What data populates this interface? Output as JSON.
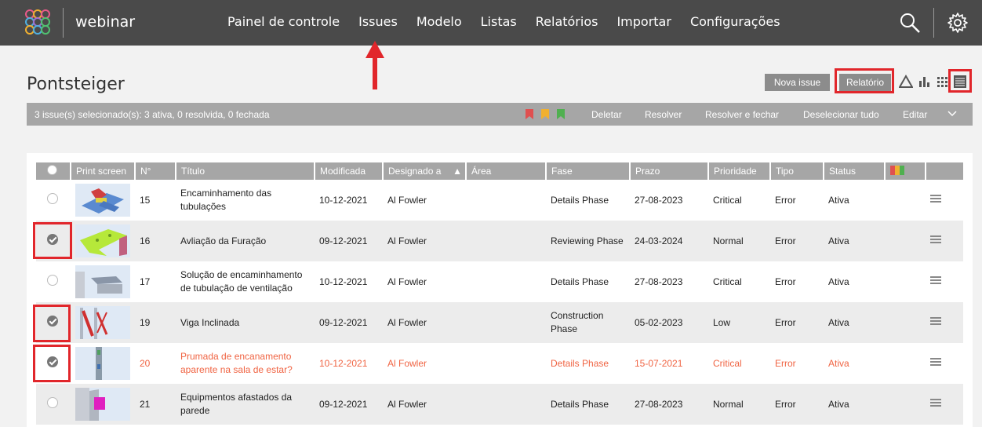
{
  "app": {
    "name": "webinar"
  },
  "nav": {
    "items": [
      "Painel de controle",
      "Issues",
      "Modelo",
      "Listas",
      "Relatórios",
      "Importar",
      "Configurações"
    ],
    "active": "Issues"
  },
  "page": {
    "title": "Pontsteiger"
  },
  "toolbar": {
    "new_issue": "Nova issue",
    "report": "Relatório"
  },
  "selection": {
    "summary": "3 issue(s) selecionado(s): 3 ativa, 0 resolvida, 0 fechada",
    "actions": [
      "Deletar",
      "Resolver",
      "Resolver e fechar",
      "Deselecionar tudo",
      "Editar"
    ],
    "flag_colors": [
      "#e05050",
      "#f0b030",
      "#50b050"
    ]
  },
  "table": {
    "headers": [
      "Print screen",
      "N°",
      "Título",
      "Modificada",
      "Designado a",
      "Área",
      "Fase",
      "Prazo",
      "Prioridade",
      "Tipo",
      "Status"
    ],
    "sort_indicator": "▲",
    "rows": [
      {
        "no": "15",
        "title": "Encaminhamento das tubulações",
        "modified": "10-12-2021",
        "assignee": "Al Fowler",
        "area": "",
        "phase": "Details Phase",
        "due": "27-08-2023",
        "priority": "Critical",
        "type": "Error",
        "status": "Ativa",
        "selected": false
      },
      {
        "no": "16",
        "title": "Avliação da Furação",
        "modified": "09-12-2021",
        "assignee": "Al Fowler",
        "area": "",
        "phase": "Reviewing Phase",
        "due": "24-03-2024",
        "priority": "Normal",
        "type": "Error",
        "status": "Ativa",
        "selected": true
      },
      {
        "no": "17",
        "title": "Solução de encaminhamento de tubulação de ventilação",
        "modified": "10-12-2021",
        "assignee": "Al Fowler",
        "area": "",
        "phase": "Details Phase",
        "due": "27-08-2023",
        "priority": "Critical",
        "type": "Error",
        "status": "Ativa",
        "selected": false
      },
      {
        "no": "19",
        "title": "Viga Inclinada",
        "modified": "09-12-2021",
        "assignee": "Al Fowler",
        "area": "",
        "phase": "Construction Phase",
        "due": "05-02-2023",
        "priority": "Low",
        "type": "Error",
        "status": "Ativa",
        "selected": true
      },
      {
        "no": "20",
        "title": "Prumada de encanamento aparente na sala de estar?",
        "modified": "10-12-2021",
        "assignee": "Al Fowler",
        "area": "",
        "phase": "Details Phase",
        "due": "15-07-2021",
        "priority": "Critical",
        "type": "Error",
        "status": "Ativa",
        "selected": true
      },
      {
        "no": "21",
        "title": "Equipmentos afastados da parede",
        "modified": "09-12-2021",
        "assignee": "Al Fowler",
        "area": "",
        "phase": "Details Phase",
        "due": "27-08-2023",
        "priority": "Normal",
        "type": "Error",
        "status": "Ativa",
        "selected": false
      }
    ]
  },
  "colors": {
    "topbar": "#4a4a4a",
    "highlight": "#e1262b",
    "overdue": "#f06443",
    "header": "#a6a6a6"
  }
}
